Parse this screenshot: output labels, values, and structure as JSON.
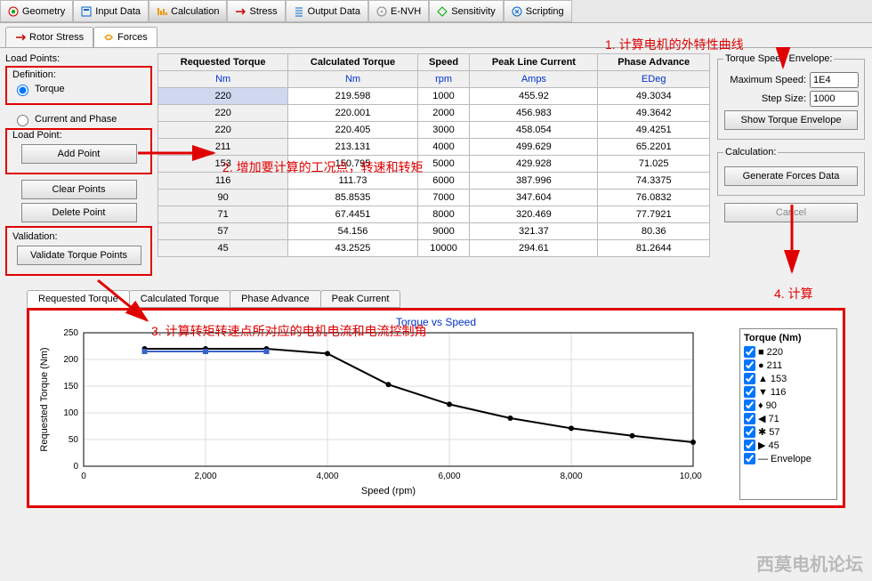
{
  "top_toolbar": [
    {
      "label": "Geometry",
      "icon": "geometry"
    },
    {
      "label": "Input Data",
      "icon": "input"
    },
    {
      "label": "Calculation",
      "icon": "calc",
      "active": true
    },
    {
      "label": "Stress",
      "icon": "stress"
    },
    {
      "label": "Output Data",
      "icon": "output"
    },
    {
      "label": "E-NVH",
      "icon": "envh"
    },
    {
      "label": "Sensitivity",
      "icon": "sens"
    },
    {
      "label": "Scripting",
      "icon": "script"
    }
  ],
  "sub_tabs": [
    {
      "label": "Rotor Stress",
      "icon": "rotor"
    },
    {
      "label": "Forces",
      "icon": "forces",
      "active": true
    }
  ],
  "left": {
    "load_points": "Load Points:",
    "definition": "Definition:",
    "opt_torque": "Torque",
    "opt_current": "Current and Phase",
    "load_point": "Load Point:",
    "add_point": "Add Point",
    "clear_points": "Clear Points",
    "delete_point": "Delete Point",
    "validation": "Validation:",
    "validate": "Validate Torque Points"
  },
  "table": {
    "headers": [
      "Requested Torque",
      "Calculated Torque",
      "Speed",
      "Peak Line Current",
      "Phase Advance"
    ],
    "units": [
      "Nm",
      "Nm",
      "rpm",
      "Amps",
      "EDeg"
    ],
    "rows": [
      [
        "220",
        "219.598",
        "1000",
        "455.92",
        "49.3034"
      ],
      [
        "220",
        "220.001",
        "2000",
        "456.983",
        "49.3642"
      ],
      [
        "220",
        "220.405",
        "3000",
        "458.054",
        "49.4251"
      ],
      [
        "211",
        "213.131",
        "4000",
        "499.629",
        "65.2201"
      ],
      [
        "153",
        "150.795",
        "5000",
        "429.928",
        "71.025"
      ],
      [
        "116",
        "111.73",
        "6000",
        "387.996",
        "74.3375"
      ],
      [
        "90",
        "85.8535",
        "7000",
        "347.604",
        "76.0832"
      ],
      [
        "71",
        "67.4451",
        "8000",
        "320.469",
        "77.7921"
      ],
      [
        "57",
        "54.156",
        "9000",
        "321.37",
        "80.36"
      ],
      [
        "45",
        "43.2525",
        "10000",
        "294.61",
        "81.2644"
      ]
    ]
  },
  "right": {
    "tse": "Torque Speed Envelope:",
    "max_speed_lbl": "Maximum Speed:",
    "max_speed": "1E4",
    "step_lbl": "Step Size:",
    "step": "1000",
    "show_envelope": "Show Torque Envelope",
    "calculation": "Calculation:",
    "generate": "Generate Forces Data",
    "cancel": "Cancel"
  },
  "annotations": {
    "a1": "1. 计算电机的外特性曲线",
    "a2": "2. 增加要计算的工况点，转速和转矩",
    "a3": "3. 计算转矩转速点所对应的电机电流和电流控制角",
    "a4": "4. 计算"
  },
  "chart_tabs": [
    "Requested Torque",
    "Calculated Torque",
    "Phase Advance",
    "Peak Current"
  ],
  "chart": {
    "title": "Torque vs Speed",
    "xlabel": "Speed (rpm)",
    "ylabel": "Requested Torque (Nm)"
  },
  "chart_data": {
    "type": "line",
    "title": "Torque vs Speed",
    "xlabel": "Speed (rpm)",
    "ylabel": "Requested Torque (Nm)",
    "xlim": [
      0,
      10000
    ],
    "ylim": [
      0,
      250
    ],
    "xticks": [
      0,
      2000,
      4000,
      6000,
      8000,
      10000
    ],
    "yticks": [
      0,
      50,
      100,
      150,
      200,
      250
    ],
    "series": [
      {
        "name": "Requested Torque",
        "x": [
          1000,
          2000,
          3000,
          4000,
          5000,
          6000,
          7000,
          8000,
          9000,
          10000
        ],
        "y": [
          220,
          220,
          220,
          211,
          153,
          116,
          90,
          71,
          57,
          45
        ]
      }
    ],
    "legend": [
      "220",
      "211",
      "153",
      "116",
      "90",
      "71",
      "57",
      "45",
      "Envelope"
    ],
    "legend_title": "Torque (Nm)"
  },
  "watermark": "西莫电机论坛"
}
